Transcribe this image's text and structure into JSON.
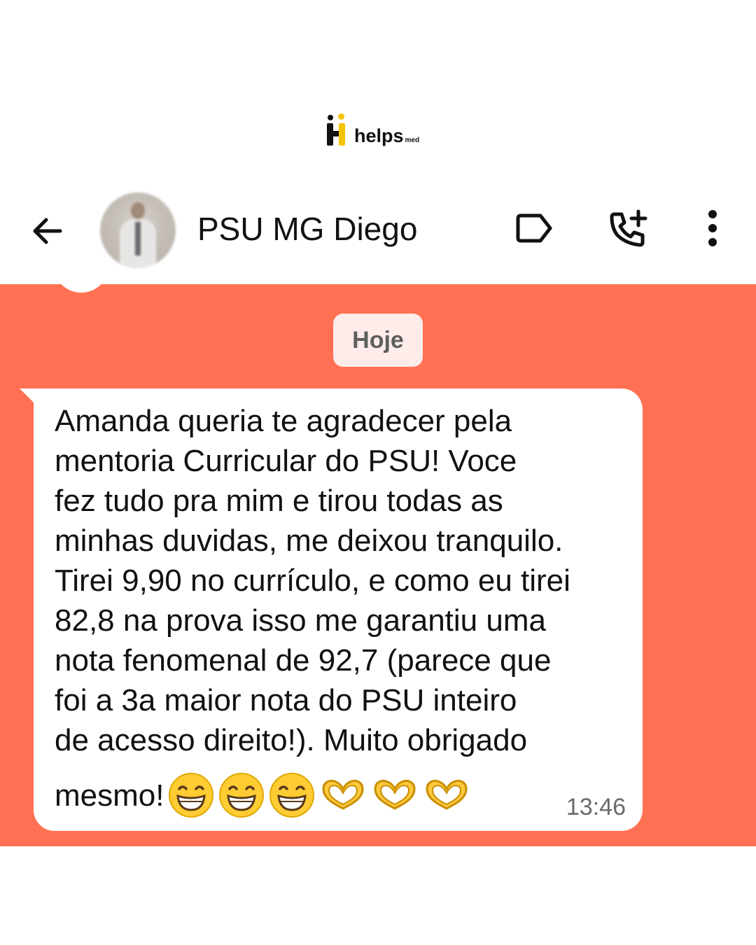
{
  "brand": {
    "name": "helps",
    "suffix": "med"
  },
  "header": {
    "contact_name": "PSU MG Diego",
    "icons": [
      "back-arrow-icon",
      "label-icon",
      "add-call-icon",
      "more-vert-icon"
    ]
  },
  "chat": {
    "background_color": "#ff7152",
    "date_chip": "Hoje",
    "message": {
      "text": "Amanda queria te agradecer pela\nmentoria Curricular do PSU! Voce\nfez tudo pra mim e tirou todas as\nminhas duvidas, me deixou tranquilo.\nTirei 9,90 no currículo, e como eu tirei\n82,8 na prova isso me garantiu uma\nnota fenomenal de 92,7 (parece que\nfoi a 3a maior nota do PSU inteiro\nde acesso direito!). Muito obrigado",
      "last_line": "mesmo!",
      "emojis": [
        "grinning-face",
        "grinning-face",
        "grinning-face",
        "heart-hands",
        "heart-hands",
        "heart-hands"
      ],
      "time": "13:46"
    }
  }
}
